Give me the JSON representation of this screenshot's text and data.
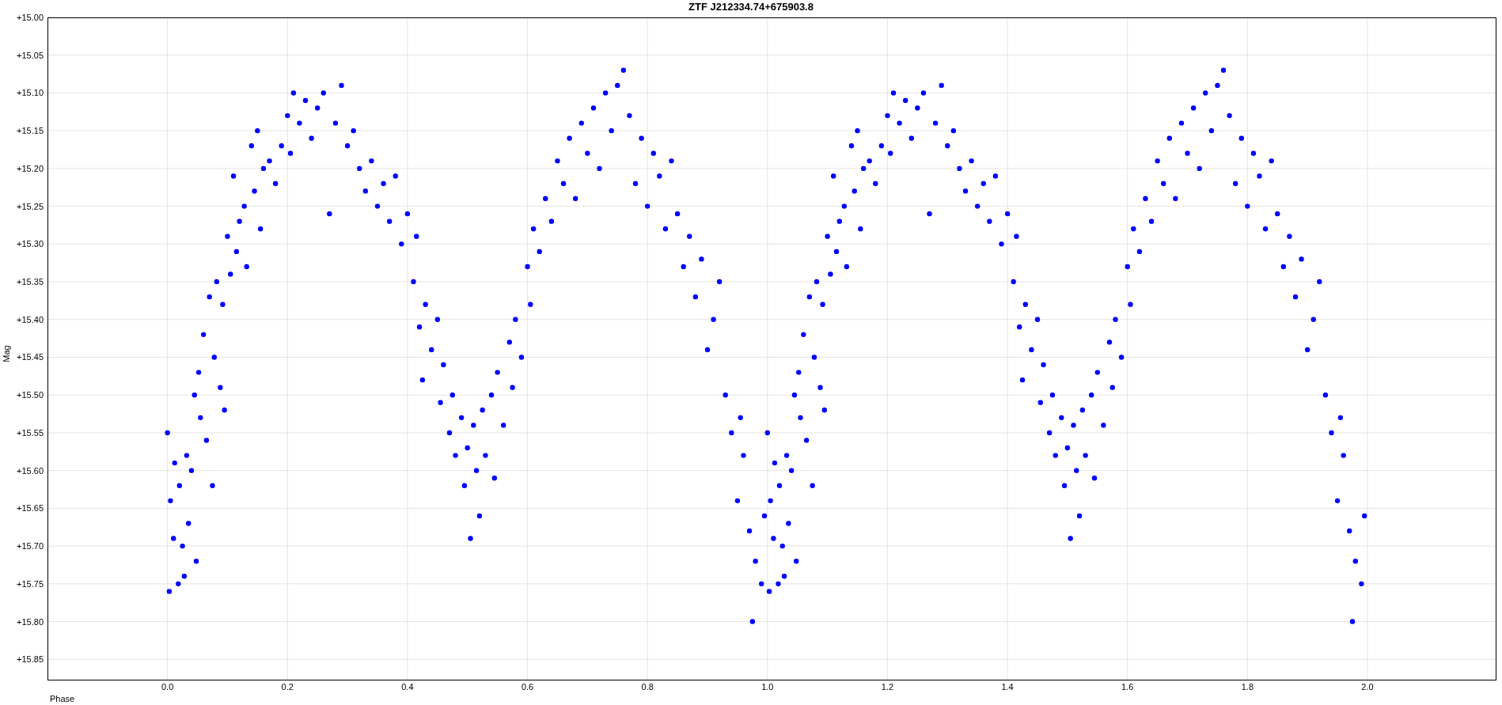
{
  "chart": {
    "chart_data": {
      "type": "scatter",
      "title": "ZTF J212334.74+675903.8",
      "xlabel": "Phase",
      "ylabel": "Mag",
      "grid": true,
      "xlim": [
        -0.2,
        2.215
      ],
      "ylim": [
        15.878,
        15.0
      ],
      "xticks": [
        {
          "value": 0,
          "label": "0.0"
        },
        {
          "value": 0.2,
          "label": "0.2"
        },
        {
          "value": 0.4,
          "label": "0.4"
        },
        {
          "value": 0.6,
          "label": "0.6"
        },
        {
          "value": 0.8,
          "label": "0.8"
        },
        {
          "value": 1.0,
          "label": "1.0"
        },
        {
          "value": 1.2,
          "label": "1.2"
        },
        {
          "value": 1.4,
          "label": "1.4"
        },
        {
          "value": 1.6,
          "label": "1.6"
        },
        {
          "value": 1.8,
          "label": "1.8"
        },
        {
          "value": 2.0,
          "label": "2.0"
        }
      ],
      "yticks": [
        {
          "value": 15.0,
          "label": "+15.00"
        },
        {
          "value": 15.05,
          "label": "+15.05"
        },
        {
          "value": 15.1,
          "label": "+15.10"
        },
        {
          "value": 15.15,
          "label": "+15.15"
        },
        {
          "value": 15.2,
          "label": "+15.20"
        },
        {
          "value": 15.25,
          "label": "+15.25"
        },
        {
          "value": 15.3,
          "label": "+15.30"
        },
        {
          "value": 15.35,
          "label": "+15.35"
        },
        {
          "value": 15.4,
          "label": "+15.40"
        },
        {
          "value": 15.45,
          "label": "+15.45"
        },
        {
          "value": 15.5,
          "label": "+15.50"
        },
        {
          "value": 15.55,
          "label": "+15.55"
        },
        {
          "value": 15.6,
          "label": "+15.60"
        },
        {
          "value": 15.65,
          "label": "+15.65"
        },
        {
          "value": 15.7,
          "label": "+15.70"
        },
        {
          "value": 15.75,
          "label": "+15.75"
        },
        {
          "value": 15.8,
          "label": "+15.80"
        },
        {
          "value": 15.85,
          "label": "+15.85"
        }
      ],
      "x": [
        0.0,
        0.003,
        0.005,
        0.01,
        0.012,
        0.018,
        0.02,
        0.025,
        0.028,
        0.032,
        0.035,
        0.04,
        0.045,
        0.048,
        0.052,
        0.055,
        0.06,
        0.065,
        0.07,
        0.075,
        0.078,
        0.082,
        0.088,
        0.092,
        0.095,
        0.1,
        0.105,
        0.11,
        0.115,
        0.12,
        0.128,
        0.132,
        0.14,
        0.145,
        0.15,
        0.155,
        0.16,
        0.17,
        0.18,
        0.19,
        0.2,
        0.205,
        0.21,
        0.22,
        0.23,
        0.24,
        0.25,
        0.26,
        0.27,
        0.28,
        0.29,
        0.3,
        0.31,
        0.32,
        0.33,
        0.34,
        0.35,
        0.36,
        0.37,
        0.38,
        0.39,
        0.4,
        0.41,
        0.415,
        0.42,
        0.425,
        0.43,
        0.44,
        0.45,
        0.455,
        0.46,
        0.47,
        0.475,
        0.48,
        0.49,
        0.495,
        0.5,
        0.505,
        0.51,
        0.515,
        0.52,
        0.525,
        0.53,
        0.54,
        0.545,
        0.55,
        0.56,
        0.57,
        0.575,
        0.58,
        0.59,
        0.6,
        0.605,
        0.61,
        0.62,
        0.63,
        0.64,
        0.65,
        0.66,
        0.67,
        0.68,
        0.69,
        0.7,
        0.71,
        0.72,
        0.73,
        0.74,
        0.75,
        0.76,
        0.77,
        0.78,
        0.79,
        0.8,
        0.81,
        0.82,
        0.83,
        0.84,
        0.85,
        0.86,
        0.87,
        0.88,
        0.89,
        0.9,
        0.91,
        0.92,
        0.93,
        0.94,
        0.95,
        0.955,
        0.96,
        0.97,
        0.975,
        0.98,
        0.99,
        0.995,
        1.0,
        1.003,
        1.005,
        1.01,
        1.012,
        1.018,
        1.02,
        1.025,
        1.028,
        1.032,
        1.035,
        1.04,
        1.045,
        1.048,
        1.052,
        1.055,
        1.06,
        1.065,
        1.07,
        1.075,
        1.078,
        1.082,
        1.088,
        1.092,
        1.095,
        1.1,
        1.105,
        1.11,
        1.115,
        1.12,
        1.128,
        1.132,
        1.14,
        1.145,
        1.15,
        1.155,
        1.16,
        1.17,
        1.18,
        1.19,
        1.2,
        1.205,
        1.21,
        1.22,
        1.23,
        1.24,
        1.25,
        1.26,
        1.27,
        1.28,
        1.29,
        1.3,
        1.31,
        1.32,
        1.33,
        1.34,
        1.35,
        1.36,
        1.37,
        1.38,
        1.39,
        1.4,
        1.41,
        1.415,
        1.42,
        1.425,
        1.43,
        1.44,
        1.45,
        1.455,
        1.46,
        1.47,
        1.475,
        1.48,
        1.49,
        1.495,
        1.5,
        1.505,
        1.51,
        1.515,
        1.52,
        1.525,
        1.53,
        1.54,
        1.545,
        1.55,
        1.56,
        1.57,
        1.575,
        1.58,
        1.59,
        1.6,
        1.605,
        1.61,
        1.62,
        1.63,
        1.64,
        1.65,
        1.66,
        1.67,
        1.68,
        1.69,
        1.7,
        1.71,
        1.72,
        1.73,
        1.74,
        1.75,
        1.76,
        1.77,
        1.78,
        1.79,
        1.8,
        1.81,
        1.82,
        1.83,
        1.84,
        1.85,
        1.86,
        1.87,
        1.88,
        1.89,
        1.9,
        1.91,
        1.92,
        1.93,
        1.94,
        1.95,
        1.955,
        1.96,
        1.97,
        1.975,
        1.98,
        1.99,
        1.995
      ],
      "values": [
        15.55,
        15.76,
        15.64,
        15.69,
        15.59,
        15.75,
        15.62,
        15.7,
        15.74,
        15.58,
        15.67,
        15.6,
        15.5,
        15.72,
        15.47,
        15.53,
        15.42,
        15.56,
        15.37,
        15.62,
        15.45,
        15.35,
        15.49,
        15.38,
        15.52,
        15.29,
        15.34,
        15.21,
        15.31,
        15.27,
        15.25,
        15.33,
        15.17,
        15.23,
        15.15,
        15.28,
        15.2,
        15.19,
        15.22,
        15.17,
        15.13,
        15.18,
        15.1,
        15.14,
        15.11,
        15.16,
        15.12,
        15.1,
        15.26,
        15.14,
        15.09,
        15.17,
        15.15,
        15.2,
        15.23,
        15.19,
        15.25,
        15.22,
        15.27,
        15.21,
        15.3,
        15.26,
        15.35,
        15.29,
        15.41,
        15.48,
        15.38,
        15.44,
        15.4,
        15.51,
        15.46,
        15.55,
        15.5,
        15.58,
        15.53,
        15.62,
        15.57,
        15.69,
        15.54,
        15.6,
        15.66,
        15.52,
        15.58,
        15.5,
        15.61,
        15.47,
        15.54,
        15.43,
        15.49,
        15.4,
        15.45,
        15.33,
        15.38,
        15.28,
        15.31,
        15.24,
        15.27,
        15.19,
        15.22,
        15.16,
        15.24,
        15.14,
        15.18,
        15.12,
        15.2,
        15.1,
        15.15,
        15.09,
        15.07,
        15.13,
        15.22,
        15.16,
        15.25,
        15.18,
        15.21,
        15.28,
        15.19,
        15.26,
        15.33,
        15.29,
        15.37,
        15.32,
        15.44,
        15.4,
        15.35,
        15.5,
        15.55,
        15.64,
        15.53,
        15.58,
        15.68,
        15.8,
        15.72,
        15.75,
        15.66,
        15.55,
        15.76,
        15.64,
        15.69,
        15.59,
        15.75,
        15.62,
        15.7,
        15.74,
        15.58,
        15.67,
        15.6,
        15.5,
        15.72,
        15.47,
        15.53,
        15.42,
        15.56,
        15.37,
        15.62,
        15.45,
        15.35,
        15.49,
        15.38,
        15.52,
        15.29,
        15.34,
        15.21,
        15.31,
        15.27,
        15.25,
        15.33,
        15.17,
        15.23,
        15.15,
        15.28,
        15.2,
        15.19,
        15.22,
        15.17,
        15.13,
        15.18,
        15.1,
        15.14,
        15.11,
        15.16,
        15.12,
        15.1,
        15.26,
        15.14,
        15.09,
        15.17,
        15.15,
        15.2,
        15.23,
        15.19,
        15.25,
        15.22,
        15.27,
        15.21,
        15.3,
        15.26,
        15.35,
        15.29,
        15.41,
        15.48,
        15.38,
        15.44,
        15.4,
        15.51,
        15.46,
        15.55,
        15.5,
        15.58,
        15.53,
        15.62,
        15.57,
        15.69,
        15.54,
        15.6,
        15.66,
        15.52,
        15.58,
        15.5,
        15.61,
        15.47,
        15.54,
        15.43,
        15.49,
        15.4,
        15.45,
        15.33,
        15.38,
        15.28,
        15.31,
        15.24,
        15.27,
        15.19,
        15.22,
        15.16,
        15.24,
        15.14,
        15.18,
        15.12,
        15.2,
        15.1,
        15.15,
        15.09,
        15.07,
        15.13,
        15.22,
        15.16,
        15.25,
        15.18,
        15.21,
        15.28,
        15.19,
        15.26,
        15.33,
        15.29,
        15.37,
        15.32,
        15.44,
        15.4,
        15.35,
        15.5,
        15.55,
        15.64,
        15.53,
        15.58,
        15.68,
        15.8,
        15.72,
        15.75,
        15.66
      ]
    }
  }
}
